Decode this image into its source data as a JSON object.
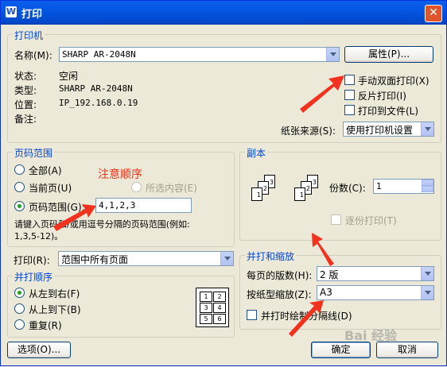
{
  "window": {
    "title": "打印",
    "app_icon_letter": "W"
  },
  "printer": {
    "group_title": "打印机",
    "name_label": "名称(M):",
    "name_value": "SHARP AR-2048N",
    "properties_button": "属性(P)...",
    "status_label": "状态:",
    "status_value": "空闲",
    "type_label": "类型:",
    "type_value": "SHARP AR-2048N",
    "location_label": "位置:",
    "location_value": "IP_192.168.0.19",
    "comment_label": "备注:",
    "duplex_label": "手动双面打印(X)",
    "reverse_label": "反片打印(I)",
    "to_file_label": "打印到文件(L)",
    "paper_source_label": "纸张来源(S):",
    "paper_source_value": "使用打印机设置"
  },
  "page_range": {
    "group_title": "页码范围",
    "all_label": "全部(A)",
    "current_label": "当前页(U)",
    "selection_label": "所选内容(E)",
    "range_label": "页码范围(G):",
    "range_value": "4,1,2,3",
    "hint_line1": "请键入页码和/或用逗号分隔的页码范围(例如:",
    "hint_line2": "1,3,5-12)。",
    "annotation": "注意顺序"
  },
  "copies": {
    "group_title": "副本",
    "count_label": "份数(C):",
    "count_value": "1",
    "collate_label": "逐份打印(T)"
  },
  "print_what": {
    "label": "打印(R):",
    "value": "范围中所有页面"
  },
  "order": {
    "group_title": "并打顺序",
    "ltr_label": "从左到右(F)",
    "ttb_label": "从上到下(B)",
    "repeat_label": "重复(R)"
  },
  "zoom": {
    "group_title": "并打和缩放",
    "pages_per_sheet_label": "每页的版数(H):",
    "pages_per_sheet_value": "2 版",
    "scale_label": "按纸型缩放(Z):",
    "scale_value": "A3",
    "border_label": "并打时绘制分隔线(D)"
  },
  "footer": {
    "options_button": "选项(O)...",
    "ok_button": "确定",
    "cancel_button": "取消"
  },
  "watermark": "Bai 经验",
  "colors": {
    "accent": "#0046d5",
    "annotation": "#e8331a"
  }
}
